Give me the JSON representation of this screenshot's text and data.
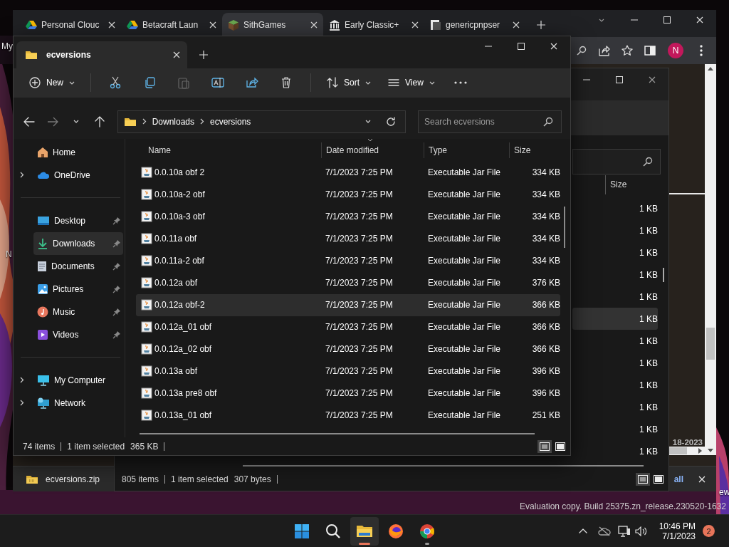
{
  "desktop": {
    "icon_labels": [
      {
        "text": "My"
      },
      {
        "text": "N"
      },
      {
        "text": "ew"
      }
    ],
    "watermark": "Evaluation copy. Build 25375.zn_release.230520-1632"
  },
  "browser": {
    "tabs": [
      {
        "title": "Personal Clouc",
        "kind": "drive",
        "selected": false
      },
      {
        "title": "Betacraft Laun",
        "kind": "drive",
        "selected": false
      },
      {
        "title": "SithGames",
        "kind": "block",
        "selected": true
      },
      {
        "title": "Early Classic+",
        "kind": "museum",
        "selected": false
      },
      {
        "title": "genericpnpser",
        "kind": "page",
        "selected": false
      }
    ],
    "profile": "N",
    "page_text": "18-2023",
    "download_bar": {
      "file": "ecversions.zip",
      "show_all": "all"
    }
  },
  "back_explorer": {
    "column": "Size",
    "rows": [
      {
        "size": "1 KB",
        "selected": false
      },
      {
        "size": "1 KB",
        "selected": false
      },
      {
        "size": "1 KB",
        "selected": false
      },
      {
        "size": "1 KB",
        "selected": false
      },
      {
        "size": "1 KB",
        "selected": false
      },
      {
        "size": "1 KB",
        "selected": true
      },
      {
        "size": "1 KB",
        "selected": false
      },
      {
        "size": "1 KB",
        "selected": false
      },
      {
        "size": "1 KB",
        "selected": false
      },
      {
        "size": "1 KB",
        "selected": false
      },
      {
        "size": "1 KB",
        "selected": false
      },
      {
        "size": "1 KB",
        "selected": false
      }
    ],
    "status": {
      "count": "805 items",
      "selection": "1 item selected",
      "size": "307 bytes"
    }
  },
  "explorer": {
    "tab": "ecversions",
    "toolbar": {
      "new": "New",
      "sort": "Sort",
      "view": "View"
    },
    "path": [
      "Downloads",
      "ecversions"
    ],
    "search": {
      "placeholder": "Search ecversions"
    },
    "nav": [
      {
        "items": [
          {
            "label": "Home",
            "kind": "home",
            "expandable": false,
            "pinned": false,
            "selected": false
          },
          {
            "label": "OneDrive",
            "kind": "cloud",
            "expandable": true,
            "pinned": false,
            "selected": false
          }
        ]
      },
      {
        "items": [
          {
            "label": "Desktop",
            "kind": "desktop",
            "expandable": false,
            "pinned": true,
            "selected": false
          },
          {
            "label": "Downloads",
            "kind": "downloads",
            "expandable": false,
            "pinned": true,
            "selected": true
          },
          {
            "label": "Documents",
            "kind": "documents",
            "expandable": false,
            "pinned": true,
            "selected": false
          },
          {
            "label": "Pictures",
            "kind": "pictures",
            "expandable": false,
            "pinned": true,
            "selected": false
          },
          {
            "label": "Music",
            "kind": "music",
            "expandable": false,
            "pinned": true,
            "selected": false
          },
          {
            "label": "Videos",
            "kind": "videos",
            "expandable": false,
            "pinned": true,
            "selected": false
          }
        ]
      },
      {
        "items": [
          {
            "label": "My Computer",
            "kind": "computer",
            "expandable": true,
            "pinned": false,
            "selected": false
          },
          {
            "label": "Network",
            "kind": "network",
            "expandable": true,
            "pinned": false,
            "selected": false
          }
        ]
      }
    ],
    "columns": [
      "Name",
      "Date modified",
      "Type",
      "Size"
    ],
    "rows": [
      {
        "name": "0.0.10a obf 2",
        "date": "7/1/2023 7:25 PM",
        "type": "Executable Jar File",
        "size": "334 KB",
        "selected": false
      },
      {
        "name": "0.0.10a-2 obf",
        "date": "7/1/2023 7:25 PM",
        "type": "Executable Jar File",
        "size": "334 KB",
        "selected": false
      },
      {
        "name": "0.0.10a-3 obf",
        "date": "7/1/2023 7:25 PM",
        "type": "Executable Jar File",
        "size": "334 KB",
        "selected": false
      },
      {
        "name": "0.0.11a obf",
        "date": "7/1/2023 7:25 PM",
        "type": "Executable Jar File",
        "size": "334 KB",
        "selected": false
      },
      {
        "name": "0.0.11a-2 obf",
        "date": "7/1/2023 7:25 PM",
        "type": "Executable Jar File",
        "size": "334 KB",
        "selected": false
      },
      {
        "name": "0.0.12a obf",
        "date": "7/1/2023 7:25 PM",
        "type": "Executable Jar File",
        "size": "376 KB",
        "selected": false
      },
      {
        "name": "0.0.12a obf-2",
        "date": "7/1/2023 7:25 PM",
        "type": "Executable Jar File",
        "size": "366 KB",
        "selected": true
      },
      {
        "name": "0.0.12a_01 obf",
        "date": "7/1/2023 7:25 PM",
        "type": "Executable Jar File",
        "size": "366 KB",
        "selected": false
      },
      {
        "name": "0.0.12a_02 obf",
        "date": "7/1/2023 7:25 PM",
        "type": "Executable Jar File",
        "size": "366 KB",
        "selected": false
      },
      {
        "name": "0.0.13a obf",
        "date": "7/1/2023 7:25 PM",
        "type": "Executable Jar File",
        "size": "396 KB",
        "selected": false
      },
      {
        "name": "0.0.13a pre8 obf",
        "date": "7/1/2023 7:25 PM",
        "type": "Executable Jar File",
        "size": "396 KB",
        "selected": false
      },
      {
        "name": "0.0.13a_01 obf",
        "date": "7/1/2023 7:25 PM",
        "type": "Executable Jar File",
        "size": "251 KB",
        "selected": false
      }
    ],
    "status": {
      "count": "74 items",
      "selection": "1 item selected",
      "size": "365 KB"
    }
  },
  "taskbar": {
    "apps": [
      {
        "kind": "start",
        "running": false,
        "active": false
      },
      {
        "kind": "search",
        "running": false,
        "active": false
      },
      {
        "kind": "explorer",
        "running": true,
        "active": true
      },
      {
        "kind": "firefox",
        "running": false,
        "active": false
      },
      {
        "kind": "chrome",
        "running": true,
        "active": false
      }
    ],
    "time": "10:46 PM",
    "date": "7/1/2023",
    "notifications": "2"
  }
}
